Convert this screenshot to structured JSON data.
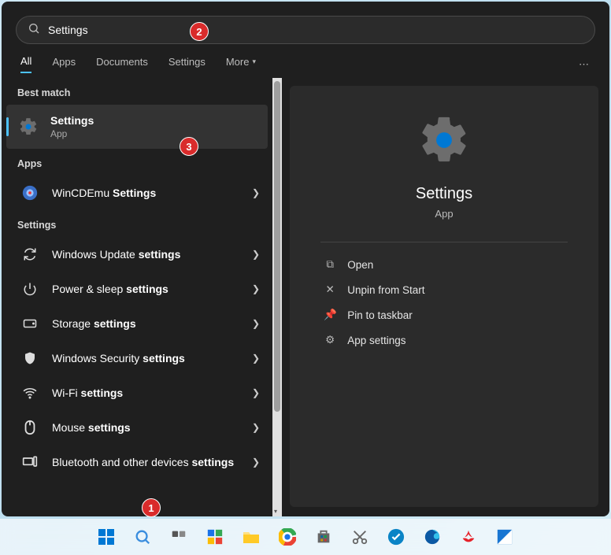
{
  "search": {
    "query": "Settings"
  },
  "tabs": {
    "items": [
      "All",
      "Apps",
      "Documents",
      "Settings",
      "More"
    ],
    "active_index": 0
  },
  "left": {
    "sections": {
      "best": {
        "label": "Best match"
      },
      "apps": {
        "label": "Apps"
      },
      "settings": {
        "label": "Settings"
      }
    },
    "best_match": {
      "title": "Settings",
      "subtitle": "App"
    },
    "apps_list": [
      {
        "prefix": "WinCDEmu ",
        "bold": "Settings"
      }
    ],
    "settings_list": [
      {
        "prefix": "Windows Update ",
        "bold": "settings"
      },
      {
        "prefix": "Power & sleep ",
        "bold": "settings"
      },
      {
        "prefix": "Storage ",
        "bold": "settings"
      },
      {
        "prefix": "Windows Security ",
        "bold": "settings"
      },
      {
        "prefix": "Wi-Fi ",
        "bold": "settings"
      },
      {
        "prefix": "Mouse ",
        "bold": "settings"
      },
      {
        "prefix": "Bluetooth and other devices ",
        "bold": "settings"
      }
    ]
  },
  "preview": {
    "title": "Settings",
    "subtitle": "App",
    "actions": [
      "Open",
      "Unpin from Start",
      "Pin to taskbar",
      "App settings"
    ]
  },
  "callouts": {
    "c1": "1",
    "c2": "2",
    "c3": "3"
  }
}
